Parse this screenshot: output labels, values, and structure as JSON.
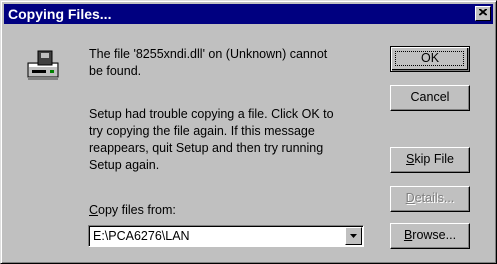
{
  "window": {
    "title": "Copying Files..."
  },
  "message": {
    "line1": "The file '8255xndi.dll' on (Unknown) cannot\nbe found.",
    "line2": "Setup had trouble copying a file. Click OK to\ntry copying the file again. If this message\nreappears, quit Setup and then try running\nSetup again."
  },
  "copy_from": {
    "label_hotkey": "C",
    "label_rest": "opy files from:",
    "value": "E:\\PCA6276\\LAN"
  },
  "buttons": {
    "ok": "OK",
    "cancel": "Cancel",
    "skip_hotkey": "S",
    "skip_rest": "kip File",
    "details_hotkey": "D",
    "details_rest": "etails...",
    "browse_hotkey": "B",
    "browse_rest": "rowse..."
  },
  "icons": {
    "title_close": "close-icon",
    "dialog": "disk-drive-icon",
    "dropdown": "chevron-down-icon"
  }
}
